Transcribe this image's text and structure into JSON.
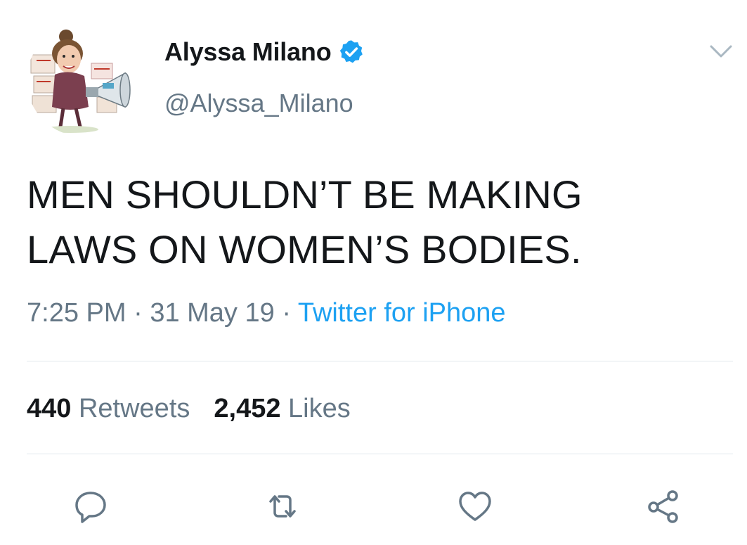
{
  "author": {
    "display_name": "Alyssa Milano",
    "handle": "@Alyssa_Milano",
    "verified": true,
    "avatar_icon": "caricature-avatar-with-megaphone"
  },
  "tweet": {
    "text_line1": "MEN SHOULDN’T BE MAKING",
    "text_line2": "LAWS ON WOMEN’S BODIES."
  },
  "meta": {
    "time": "7:25 PM",
    "separator": " · ",
    "date": "31 May 19",
    "source": "Twitter for iPhone"
  },
  "stats": {
    "retweets_count": "440",
    "retweets_label": "Retweets",
    "likes_count": "2,452",
    "likes_label": "Likes"
  },
  "actions": {
    "reply_icon": "reply-icon",
    "retweet_icon": "retweet-icon",
    "like_icon": "heart-icon",
    "share_icon": "share-icon"
  },
  "colors": {
    "link": "#1da1f2",
    "secondary_text": "#657786",
    "primary_text": "#14171a",
    "divider": "#e1e8ed"
  }
}
